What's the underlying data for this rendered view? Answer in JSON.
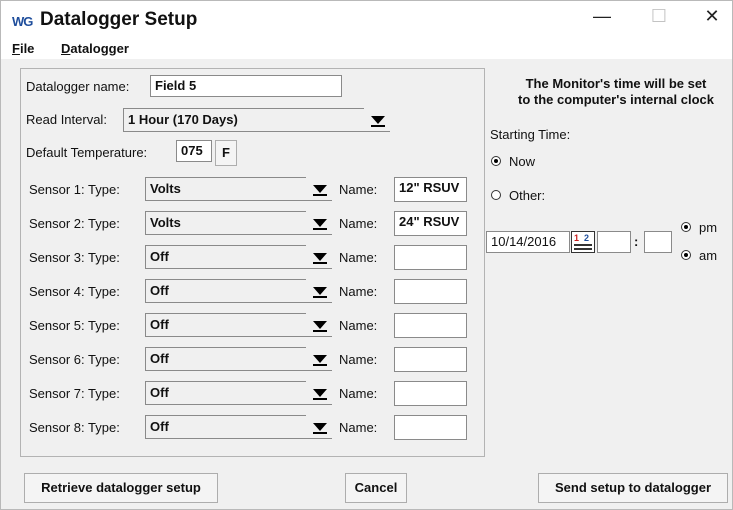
{
  "window": {
    "logo": "WG",
    "title": "Datalogger Setup",
    "minimize": "—",
    "maximize": "☐",
    "close": "✕"
  },
  "menu": {
    "file_first": "F",
    "file_rest": "ile",
    "datalogger_first": "D",
    "datalogger_rest": "atalogger"
  },
  "setup": {
    "name_label": "Datalogger name:",
    "name_value": "Field 5",
    "read_interval_label": "Read Interval:",
    "read_interval_value": "1 Hour (170 Days)",
    "default_temp_label": "Default Temperature:",
    "default_temp_value": "075",
    "temp_unit_button": "F"
  },
  "sensor_name_label": "Name:",
  "sensors": [
    {
      "label": "Sensor 1: Type:",
      "type": "Volts",
      "name": "12\" RSUV"
    },
    {
      "label": "Sensor 2: Type:",
      "type": "Volts",
      "name": "24\" RSUV"
    },
    {
      "label": "Sensor 3: Type:",
      "type": "Off",
      "name": ""
    },
    {
      "label": "Sensor 4: Type:",
      "type": "Off",
      "name": ""
    },
    {
      "label": "Sensor 5: Type:",
      "type": "Off",
      "name": ""
    },
    {
      "label": "Sensor 6: Type:",
      "type": "Off",
      "name": ""
    },
    {
      "label": "Sensor 7: Type:",
      "type": "Off",
      "name": ""
    },
    {
      "label": "Sensor 8: Type:",
      "type": "Off",
      "name": ""
    }
  ],
  "time": {
    "info_line1": "The Monitor's time will be set",
    "info_line2": "to the computer's internal clock",
    "starting_label": "Starting Time:",
    "now_label": "Now",
    "other_label": "Other:",
    "date_value": "10/14/2016",
    "calendar_digits_a": "1",
    "calendar_digits_b": "2",
    "hour_value": "",
    "colon": ":",
    "minute_value": "",
    "pm_label": "pm",
    "am_label": "am",
    "selected_start": "Now",
    "selected_period": "both"
  },
  "buttons": {
    "retrieve": "Retrieve datalogger setup",
    "cancel": "Cancel",
    "send": "Send setup to datalogger"
  }
}
